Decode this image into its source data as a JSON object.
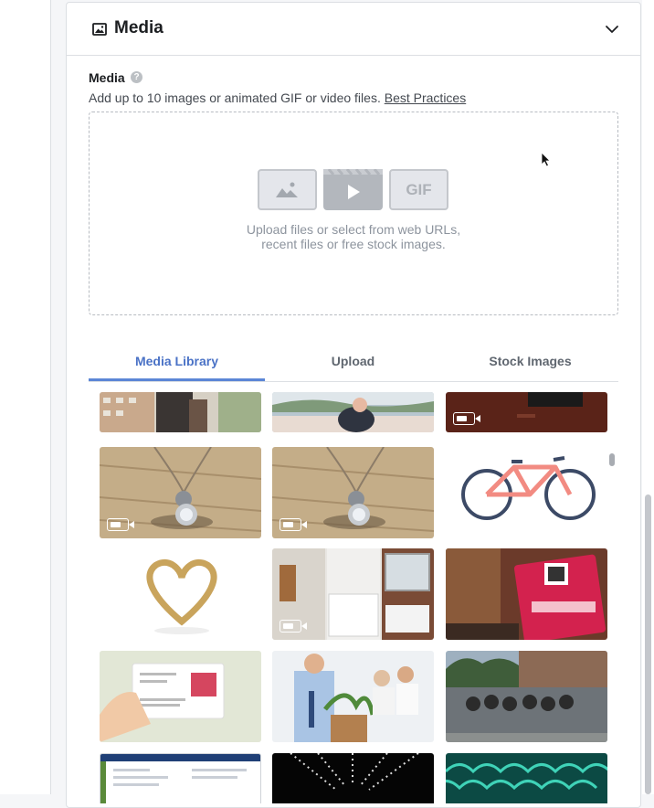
{
  "section": {
    "title": "Media"
  },
  "media_field": {
    "label": "Media",
    "help": "?",
    "description": "Add up to 10 images or animated GIF or video files.",
    "link": "Best Practices"
  },
  "dropzone": {
    "gif_label": "GIF",
    "line1": "Upload files or select from web URLs,",
    "line2": "recent files or free stock images."
  },
  "tabs": [
    "Media Library",
    "Upload",
    "Stock Images"
  ],
  "active_tab": "Media Library"
}
